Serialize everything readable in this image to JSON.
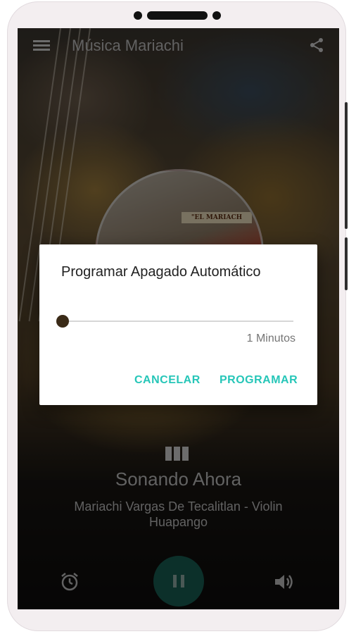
{
  "app_bar": {
    "title": "Música Mariachi",
    "menu_icon": "menu-icon",
    "share_icon": "share-icon"
  },
  "album_art": {
    "sign_text": "\"EL MARIACH"
  },
  "now_playing": {
    "heading": "Sonando Ahora",
    "track": "Mariachi Vargas De Tecalitlan - Violin Huapango"
  },
  "controls": {
    "alarm_icon": "alarm-clock-icon",
    "pause_icon": "pause-icon",
    "volume_icon": "volume-icon"
  },
  "dialog": {
    "title": "Programar Apagado Automático",
    "slider_value_label": "1 Minutos",
    "slider_value": 1,
    "cancel_label": "CANCELAR",
    "confirm_label": "PROGRAMAR"
  },
  "colors": {
    "accent": "#26c6b8",
    "play_button": "#175c52",
    "slider_thumb": "#3a2a17"
  }
}
